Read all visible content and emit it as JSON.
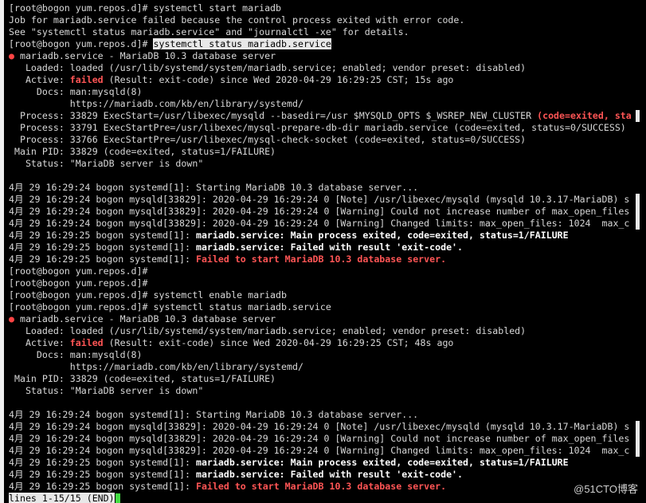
{
  "prompt": "[root@bogon yum.repos.d]# ",
  "lines": [
    {
      "kind": "plain",
      "text": "[root@bogon yum.repos.d]# systemctl start mariadb"
    },
    {
      "kind": "plain",
      "text": "Job for mariadb.service failed because the control process exited with error code."
    },
    {
      "kind": "plain",
      "text": "See \"systemctl status mariadb.service\" and \"journalctl -xe\" for details."
    },
    {
      "kind": "cmd_hl",
      "prompt": "[root@bogon yum.repos.d]# ",
      "cmd": "systemctl status mariadb.service"
    },
    {
      "kind": "dot",
      "bullet": "●",
      "text": " mariadb.service - MariaDB 10.3 database server"
    },
    {
      "kind": "plain",
      "text": "   Loaded: loaded (/usr/lib/systemd/system/mariadb.service; enabled; vendor preset: disabled)"
    },
    {
      "kind": "active",
      "label": "   Active: ",
      "state": "failed",
      "rest": " (Result: exit-code) since Wed 2020-04-29 16:29:25 CST; 15s ago"
    },
    {
      "kind": "plain",
      "text": "     Docs: man:mysqld(8)"
    },
    {
      "kind": "plain",
      "text": "           https://mariadb.com/kb/en/library/systemd/"
    },
    {
      "kind": "process_red",
      "text": "  Process: 33829 ExecStart=/usr/libexec/mysqld --basedir=/usr $MYSQLD_OPTS $_WSREP_NEW_CLUSTER ",
      "red": "(code=exited, sta",
      "trunc": true
    },
    {
      "kind": "plain",
      "text": "  Process: 33791 ExecStartPre=/usr/libexec/mysql-prepare-db-dir mariadb.service (code=exited, status=0/SUCCESS)"
    },
    {
      "kind": "plain",
      "text": "  Process: 33766 ExecStartPre=/usr/libexec/mysql-check-socket (code=exited, status=0/SUCCESS)"
    },
    {
      "kind": "plain",
      "text": " Main PID: 33829 (code=exited, status=1/FAILURE)"
    },
    {
      "kind": "plain",
      "text": "   Status: \"MariaDB server is down\""
    },
    {
      "kind": "blank"
    },
    {
      "kind": "plain",
      "text": "4月 29 16:29:24 bogon systemd[1]: Starting MariaDB 10.3 database server..."
    },
    {
      "kind": "plain",
      "text": "4月 29 16:29:24 bogon mysqld[33829]: 2020-04-29 16:29:24 0 [Note] /usr/libexec/mysqld (mysqld 10.3.17-MariaDB) s",
      "trunc": true
    },
    {
      "kind": "plain",
      "text": "4月 29 16:29:24 bogon mysqld[33829]: 2020-04-29 16:29:24 0 [Warning] Could not increase number of max_open_files",
      "trunc": true
    },
    {
      "kind": "plain",
      "text": "4月 29 16:29:24 bogon mysqld[33829]: 2020-04-29 16:29:24 0 [Warning] Changed limits: max_open_files: 1024  max_c",
      "trunc": true
    },
    {
      "kind": "boldmsg",
      "prefix": "4月 29 16:29:25 bogon systemd[1]: ",
      "msg": "mariadb.service: Main process exited, code=exited, status=1/FAILURE"
    },
    {
      "kind": "boldmsg",
      "prefix": "4月 29 16:29:25 bogon systemd[1]: ",
      "msg": "mariadb.service: Failed with result 'exit-code'."
    },
    {
      "kind": "redmsg",
      "prefix": "4月 29 16:29:25 bogon systemd[1]: ",
      "msg": "Failed to start MariaDB 10.3 database server."
    },
    {
      "kind": "plain",
      "text": "[root@bogon yum.repos.d]#"
    },
    {
      "kind": "plain",
      "text": "[root@bogon yum.repos.d]#"
    },
    {
      "kind": "plain",
      "text": "[root@bogon yum.repos.d]# systemctl enable mariadb"
    },
    {
      "kind": "plain",
      "text": "[root@bogon yum.repos.d]# systemctl status mariadb.service"
    },
    {
      "kind": "dot",
      "bullet": "●",
      "text": " mariadb.service - MariaDB 10.3 database server"
    },
    {
      "kind": "plain",
      "text": "   Loaded: loaded (/usr/lib/systemd/system/mariadb.service; enabled; vendor preset: disabled)"
    },
    {
      "kind": "active",
      "label": "   Active: ",
      "state": "failed",
      "rest": " (Result: exit-code) since Wed 2020-04-29 16:29:25 CST; 48s ago"
    },
    {
      "kind": "plain",
      "text": "     Docs: man:mysqld(8)"
    },
    {
      "kind": "plain",
      "text": "           https://mariadb.com/kb/en/library/systemd/"
    },
    {
      "kind": "plain",
      "text": " Main PID: 33829 (code=exited, status=1/FAILURE)"
    },
    {
      "kind": "plain",
      "text": "   Status: \"MariaDB server is down\""
    },
    {
      "kind": "blank"
    },
    {
      "kind": "plain",
      "text": "4月 29 16:29:24 bogon systemd[1]: Starting MariaDB 10.3 database server..."
    },
    {
      "kind": "plain",
      "text": "4月 29 16:29:24 bogon mysqld[33829]: 2020-04-29 16:29:24 0 [Note] /usr/libexec/mysqld (mysqld 10.3.17-MariaDB) s",
      "trunc": true
    },
    {
      "kind": "plain",
      "text": "4月 29 16:29:24 bogon mysqld[33829]: 2020-04-29 16:29:24 0 [Warning] Could not increase number of max_open_files",
      "trunc": true
    },
    {
      "kind": "plain",
      "text": "4月 29 16:29:24 bogon mysqld[33829]: 2020-04-29 16:29:24 0 [Warning] Changed limits: max_open_files: 1024  max_c",
      "trunc": true
    },
    {
      "kind": "boldmsg",
      "prefix": "4月 29 16:29:25 bogon systemd[1]: ",
      "msg": "mariadb.service: Main process exited, code=exited, status=1/FAILURE"
    },
    {
      "kind": "boldmsg",
      "prefix": "4月 29 16:29:25 bogon systemd[1]: ",
      "msg": "mariadb.service: Failed with result 'exit-code'."
    },
    {
      "kind": "redmsg",
      "prefix": "4月 29 16:29:25 bogon systemd[1]: ",
      "msg": "Failed to start MariaDB 10.3 database server."
    }
  ],
  "pager_status": "lines 1-15/15 (END)",
  "watermark": "@51CTO博客",
  "colors": {
    "background": "#000000",
    "text": "#d8d8d8",
    "error_red": "#ff5555",
    "cursor_green": "#44dd44",
    "selection": "#e8e8e8"
  }
}
